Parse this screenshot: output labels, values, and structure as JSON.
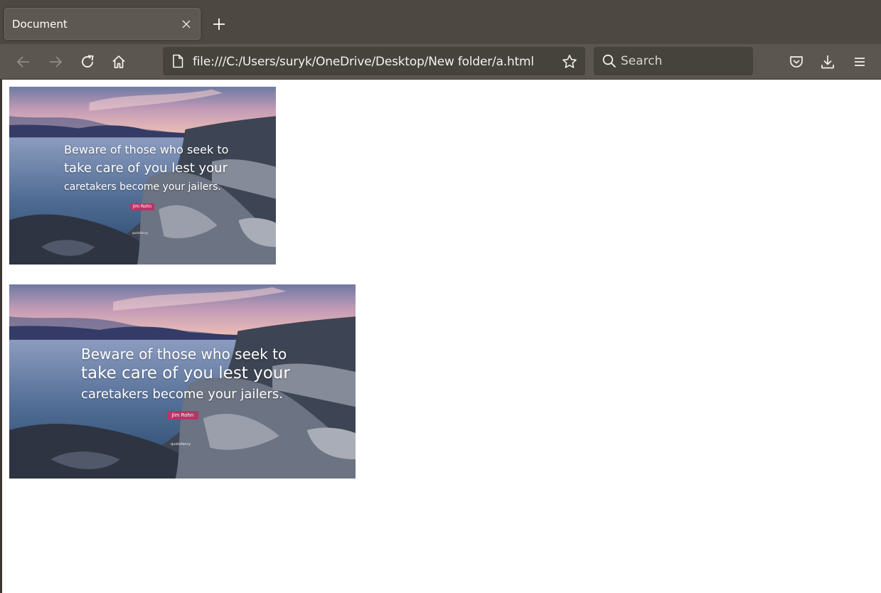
{
  "browser": {
    "tab": {
      "title": "Document"
    },
    "url": "file:///C:/Users/suryk/OneDrive/Desktop/New folder/a.html",
    "search": {
      "placeholder": "Search"
    },
    "icons": [
      "close-icon",
      "plus-icon",
      "back-arrow-icon",
      "forward-arrow-icon",
      "reload-icon",
      "home-icon",
      "page-icon",
      "star-icon",
      "search-icon",
      "pocket-icon",
      "download-icon",
      "menu-icon"
    ],
    "colors": {
      "tabbar": "#4d4841",
      "navbar": "#5c5650",
      "urlbar": "#46423c"
    }
  },
  "page": {
    "images": [
      {
        "quote_lines": [
          "Beware of those who seek to",
          "take care of you lest your",
          "caretakers become your jailers."
        ],
        "author": "Jim Rohn",
        "brand": "quotefancy"
      },
      {
        "quote_lines": [
          "Beware of those who seek to",
          "take care of you lest your",
          "caretakers become your jailers."
        ],
        "author": "Jim Rohn",
        "brand": "quotefancy"
      }
    ],
    "colors": {
      "author_badge": "#b83467",
      "background": "#ffffff"
    }
  }
}
